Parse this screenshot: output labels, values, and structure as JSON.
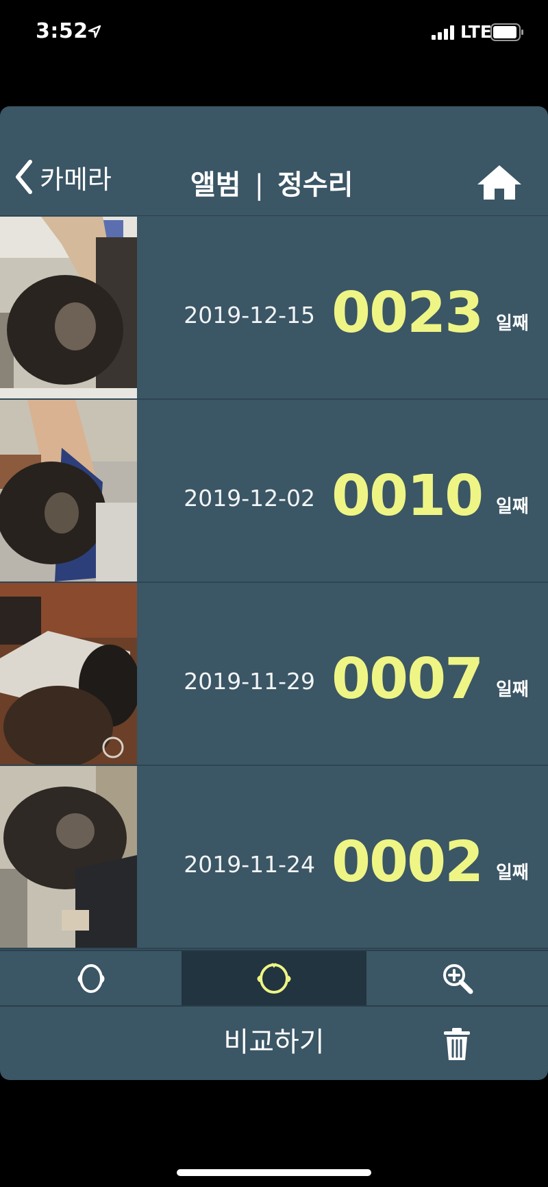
{
  "status_bar": {
    "time": "3:52",
    "network": "LTE",
    "icons": [
      "location-arrow-icon",
      "signal-bars-icon",
      "battery-icon"
    ]
  },
  "nav": {
    "back_label": "카메라",
    "title_left": "앨범",
    "title_sep": "|",
    "title_right": "정수리",
    "icons": [
      "chevron-left-icon",
      "home-icon"
    ]
  },
  "rows": [
    {
      "date": "2019-12-15",
      "day": "0023",
      "suffix": "일째"
    },
    {
      "date": "2019-12-02",
      "day": "0010",
      "suffix": "일째"
    },
    {
      "date": "2019-11-29",
      "day": "0007",
      "suffix": "일째"
    },
    {
      "date": "2019-11-24",
      "day": "0002",
      "suffix": "일째"
    }
  ],
  "mode_tabs": {
    "icons": [
      "head-front-icon",
      "head-top-icon",
      "zoom-in-icon"
    ],
    "selected_index": 1
  },
  "bottom": {
    "compare_label": "비교하기",
    "icons": [
      "trash-icon"
    ]
  },
  "colors": {
    "background": "#000000",
    "panel": "#3b5665",
    "selected_tab": "#22343f",
    "day_number": "#eef585",
    "text": "#ffffff"
  }
}
